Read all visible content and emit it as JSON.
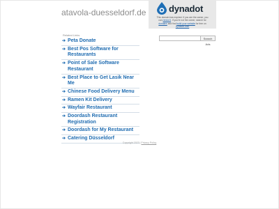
{
  "header": {
    "domain": "atavola-duesseldorf.de"
  },
  "promo": {
    "logo_text": "dynadot",
    "logo_icon": "dynadot-drop-icon",
    "line1_a": "This domain has expired. If you are the owner, you",
    "line1_b": "can",
    "line1_link": "renew it",
    "line1_c": ". If you're not the owner, search for",
    "line2_link": "domains",
    "line2_a": "and find",
    "line2_link2": "build your website",
    "line2_b": "for free on",
    "line3_link": "Dynadot.com",
    "accent": "#1f6fb6"
  },
  "search": {
    "placeholder": "",
    "button_label": "Search Ads"
  },
  "related": {
    "heading": "Related Links",
    "arrow": "➔",
    "links": [
      "Peta Donate",
      "Best Pos Software for Restaurants",
      "Point of Sale Software Restaurant",
      "Best Place to Get Lasik Near Me",
      "Chinese Food Delivery Menu",
      "Ramen Kit Delivery",
      "Wayfair Restaurant",
      "Doordash Restaurant Registration",
      "Doordash for My Restaurant",
      "Catering Düsseldorf"
    ]
  },
  "footer": {
    "copyright": "Copyright 2023 |",
    "privacy": "Privacy Policy"
  }
}
